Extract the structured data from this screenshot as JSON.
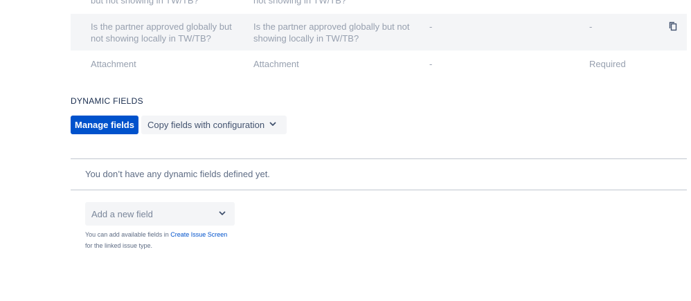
{
  "table": {
    "partial_row": {
      "col1": "but not showing in TW/TB?",
      "col2": "not showing in TW/TB?"
    },
    "rows": [
      {
        "col1": "Is the partner approved globally but not showing locally in TW/TB?",
        "col2": "Is the partner approved globally but not showing locally in TW/TB?",
        "col3": "-",
        "col4": "-",
        "icon": "copy-icon"
      },
      {
        "col1": "Attachment",
        "col2": "Attachment",
        "col3": "-",
        "col4": "Required"
      }
    ]
  },
  "dynamic_fields": {
    "title": "DYNAMIC FIELDS",
    "manage_button": "Manage fields",
    "copy_button": "Copy fields with configuration",
    "empty_message": "You don’t have any dynamic fields defined yet.",
    "add_field_placeholder": "Add a new field",
    "help_prefix": "You can add available fields in ",
    "help_link": "Create Issue Screen",
    "help_suffix": "for the linked issue type."
  },
  "colors": {
    "primary": "#0052cc",
    "row_shade": "#f4f5f7",
    "muted_text": "#97a0af"
  }
}
